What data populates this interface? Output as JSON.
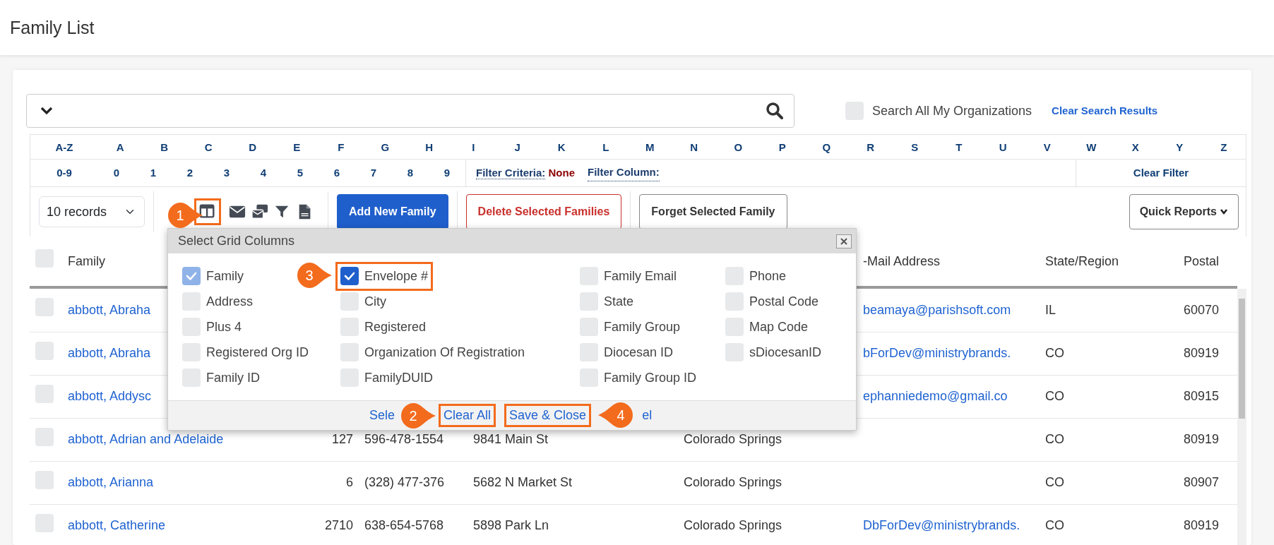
{
  "page_title": "Family List",
  "search": {
    "all_orgs": {
      "label": "Search All My Organizations",
      "checked": false
    },
    "clear_link": "Clear Search Results"
  },
  "letters": [
    "A-Z",
    "A",
    "B",
    "C",
    "D",
    "E",
    "F",
    "G",
    "H",
    "I",
    "J",
    "K",
    "L",
    "M",
    "N",
    "O",
    "P",
    "Q",
    "R",
    "S",
    "T",
    "U",
    "V",
    "W",
    "X",
    "Y",
    "Z"
  ],
  "digits": [
    "0-9",
    "0",
    "1",
    "2",
    "3",
    "4",
    "5",
    "6",
    "7",
    "8",
    "9"
  ],
  "filter": {
    "criteria_label": "Filter Criteria:",
    "criteria_value": "None",
    "column_label": "Filter Column:",
    "clear": "Clear Filter"
  },
  "records": "10 records",
  "toolbar_icons": [
    {
      "kind": "columns",
      "highlighted": true
    },
    {
      "kind": "email",
      "highlighted": false
    },
    {
      "kind": "mass-email",
      "highlighted": false
    },
    {
      "kind": "filter",
      "highlighted": false
    },
    {
      "kind": "csv",
      "highlighted": false
    }
  ],
  "buttons": [
    {
      "label": "Add New Family",
      "kind": "primary"
    },
    {
      "label": "Delete Selected Families",
      "kind": "danger"
    },
    {
      "label": "Forget Selected Family",
      "kind": "outline"
    }
  ],
  "quick_reports": "Quick Reports",
  "table": {
    "header_selected": false,
    "columns": [
      "Family",
      "-Mail Address",
      "State/Region",
      "Postal"
    ],
    "rows": [
      {
        "selected": false,
        "family": "abbott, Abraha",
        "email": "beamaya@parishsoft.com",
        "state": "IL",
        "postal": "60070"
      },
      {
        "selected": false,
        "family": "abbott, Abraha",
        "email": "bForDev@ministrybrands.",
        "state": "CO",
        "postal": "80919"
      },
      {
        "selected": false,
        "family": "abbott, Addysc",
        "email": "ephanniedemo@gmail.co",
        "state": "CO",
        "postal": "80915"
      },
      {
        "selected": false,
        "family": "abbott, Adrian and Adelaide",
        "details": [
          "127",
          "596-478-1554",
          "9841 Main St",
          "Colorado Springs"
        ],
        "state": "CO",
        "postal": "80919"
      },
      {
        "selected": false,
        "family": "abbott, Arianna",
        "details": [
          "6",
          "(328) 477-376",
          "5682 N Market St",
          "Colorado Springs"
        ],
        "state": "CO",
        "postal": "80907"
      },
      {
        "selected": false,
        "family": "abbott, Catherine",
        "details": [
          "2710",
          "638-654-5768",
          "5898 Park Ln",
          "Colorado Springs"
        ],
        "email": "DbForDev@ministrybrands.",
        "state": "CO",
        "postal": "80919"
      }
    ]
  },
  "dialog": {
    "title": "Select Grid Columns",
    "options": [
      {
        "label": "Family",
        "checked": true,
        "disabled": true,
        "highlighted": false
      },
      {
        "label": "Envelope #",
        "checked": true,
        "disabled": false,
        "highlighted": true
      },
      {
        "label": "Family Email",
        "checked": false,
        "disabled": false,
        "highlighted": false
      },
      {
        "label": "Phone",
        "checked": false,
        "disabled": false,
        "highlighted": false
      },
      {
        "label": "Address",
        "checked": false,
        "disabled": false,
        "highlighted": false
      },
      {
        "label": "City",
        "checked": false,
        "disabled": false,
        "highlighted": false
      },
      {
        "label": "State",
        "checked": false,
        "disabled": false,
        "highlighted": false
      },
      {
        "label": "Postal Code",
        "checked": false,
        "disabled": false,
        "highlighted": false
      },
      {
        "label": "Plus 4",
        "checked": false,
        "disabled": false,
        "highlighted": false
      },
      {
        "label": "Registered",
        "checked": false,
        "disabled": false,
        "highlighted": false
      },
      {
        "label": "Family Group",
        "checked": false,
        "disabled": false,
        "highlighted": false
      },
      {
        "label": "Map Code",
        "checked": false,
        "disabled": false,
        "highlighted": false
      },
      {
        "label": "Registered Org ID",
        "checked": false,
        "disabled": false,
        "highlighted": false
      },
      {
        "label": "Organization Of Registration",
        "checked": false,
        "disabled": false,
        "highlighted": false
      },
      {
        "label": "Diocesan ID",
        "checked": false,
        "disabled": false,
        "highlighted": false
      },
      {
        "label": "sDiocesanID",
        "checked": false,
        "disabled": false,
        "highlighted": false
      },
      {
        "label": "Family ID",
        "checked": false,
        "disabled": false,
        "highlighted": false
      },
      {
        "label": "FamilyDUID",
        "checked": false,
        "disabled": false,
        "highlighted": false
      },
      {
        "label": "Family Group ID",
        "checked": false,
        "disabled": false,
        "highlighted": false
      }
    ],
    "footer_links": [
      {
        "label": "Sele",
        "highlighted": false
      },
      {
        "label": "Clear All",
        "highlighted": true
      },
      {
        "label": "Save & Close",
        "highlighted": true
      },
      {
        "label": "el",
        "highlighted": false
      }
    ]
  },
  "callouts": [
    {
      "label": "1"
    },
    {
      "label": "2"
    },
    {
      "label": "3"
    },
    {
      "label": "4"
    }
  ]
}
